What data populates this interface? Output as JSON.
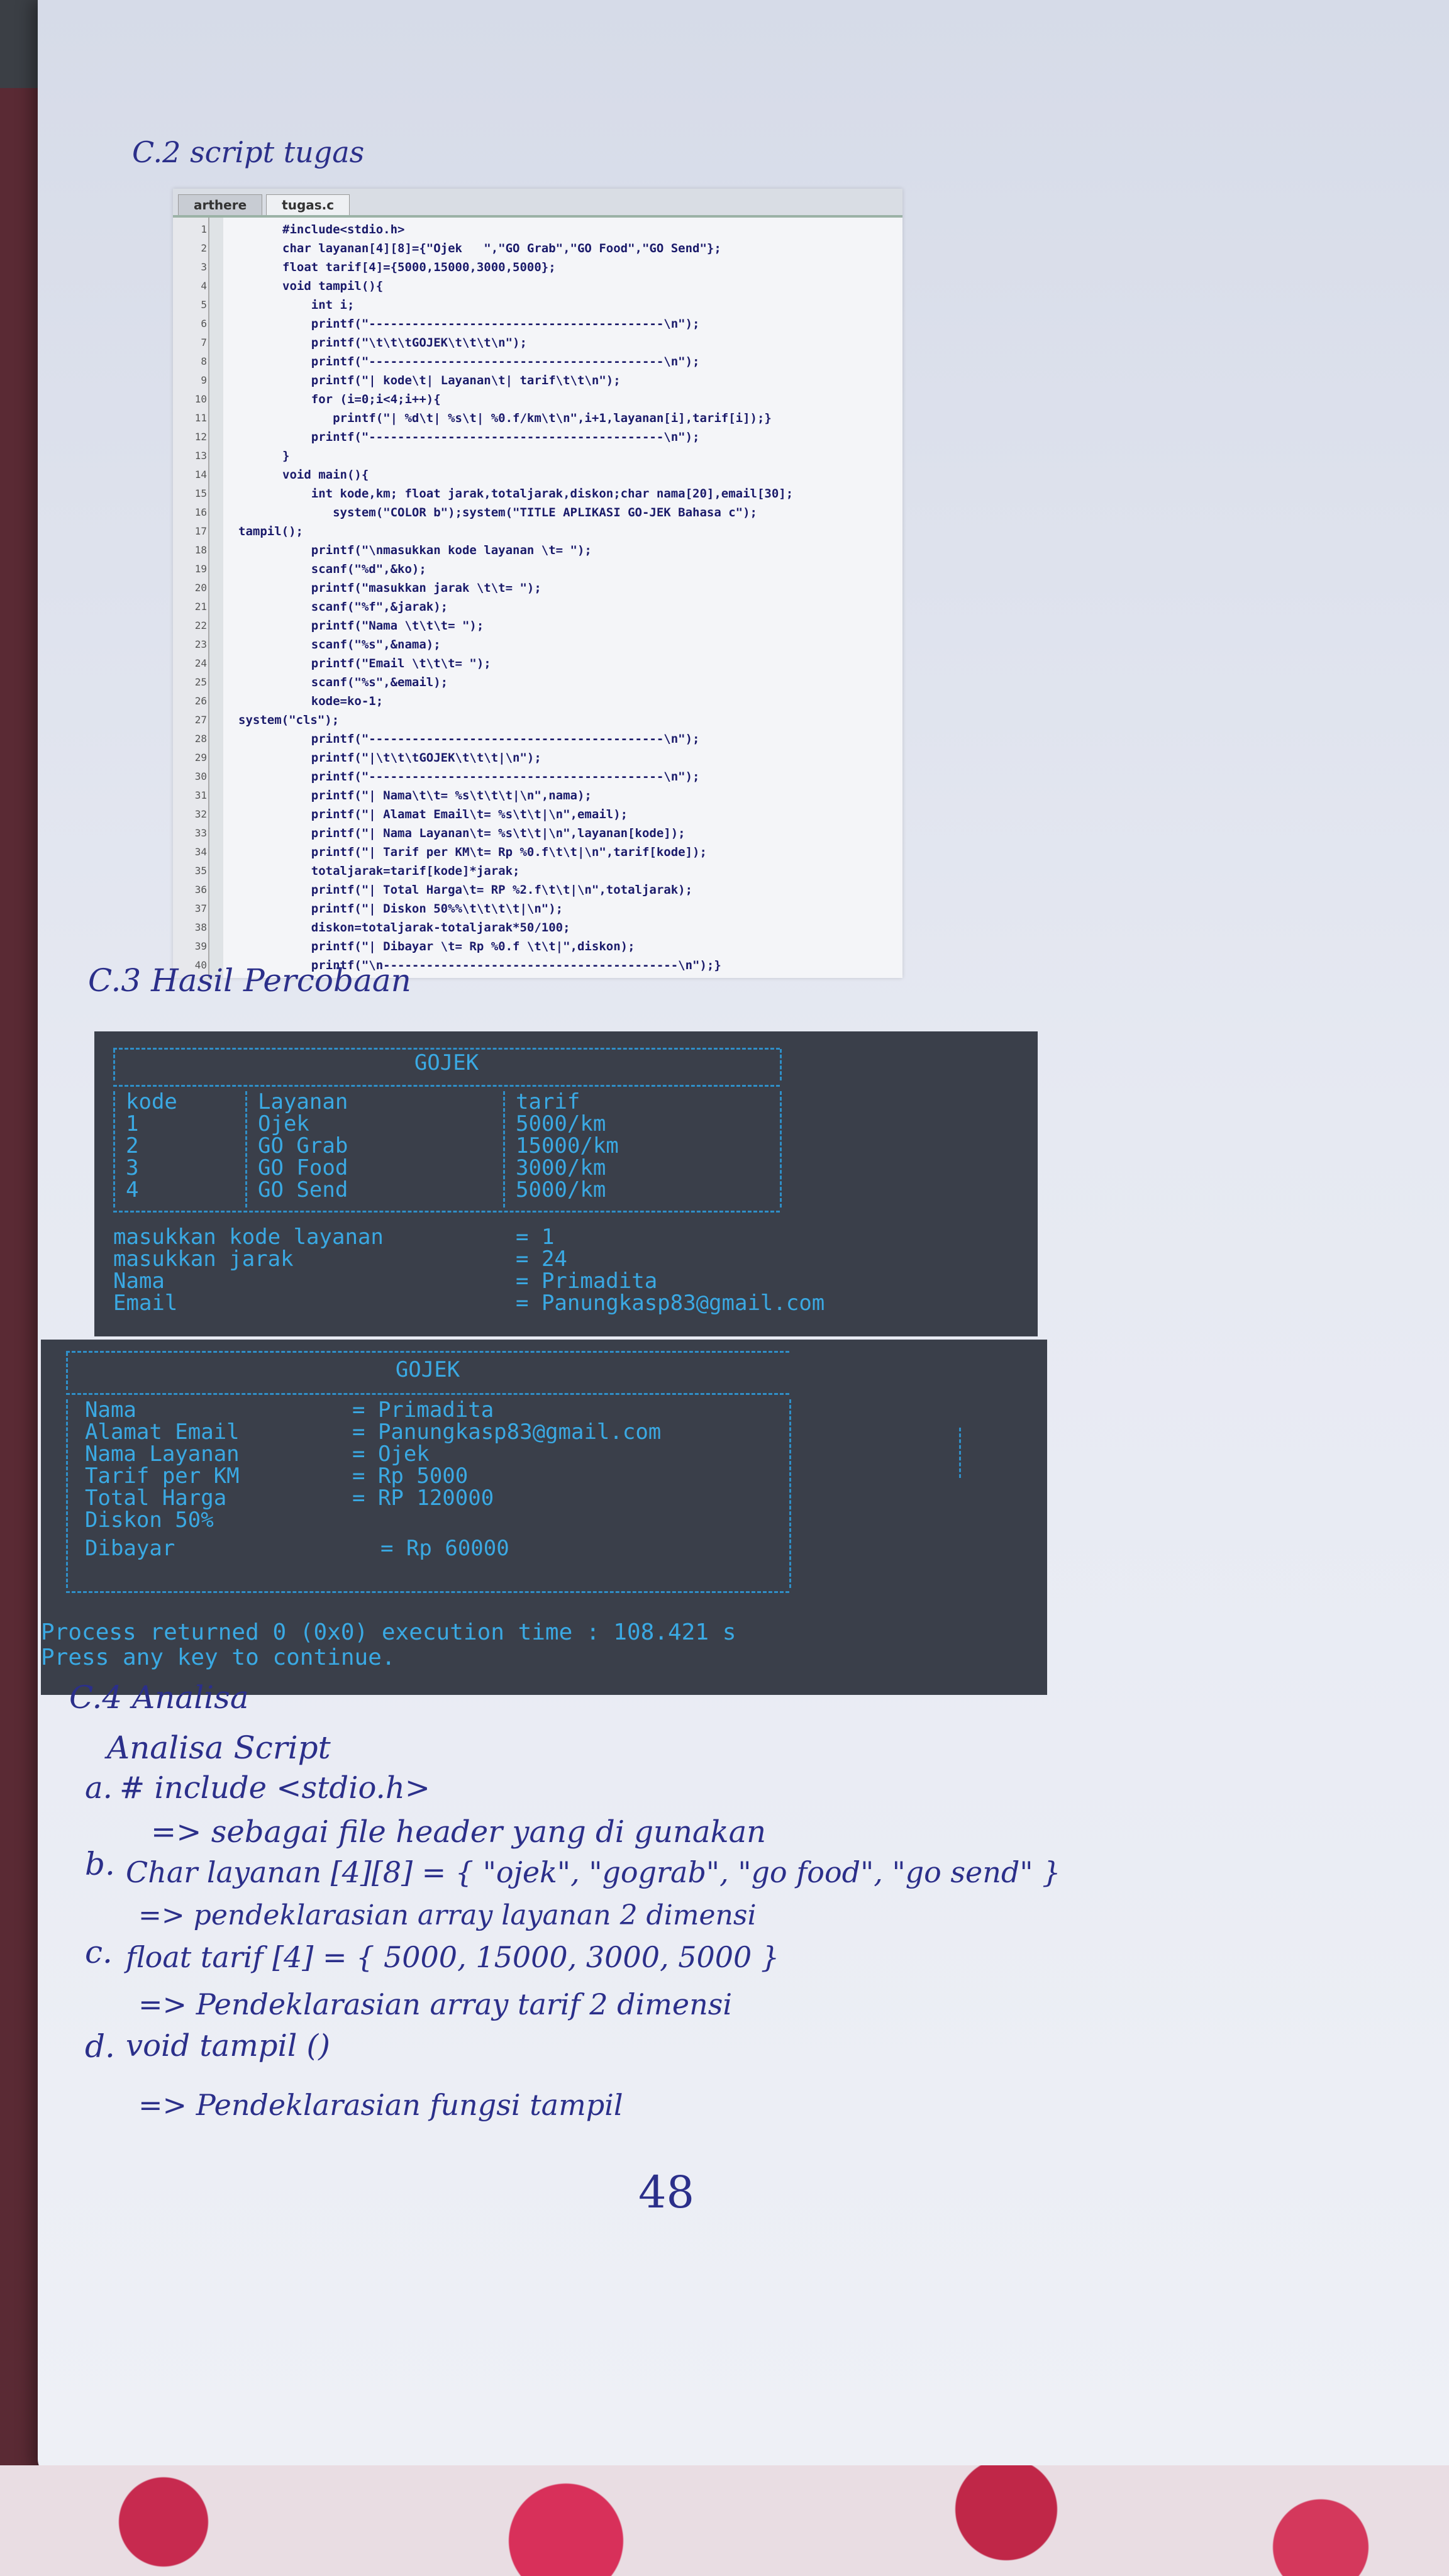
{
  "section_c2_title": "C.2 script tugas",
  "editor": {
    "tabs": [
      "arthere",
      "tugas.c"
    ],
    "lines": [
      {
        "n": "1",
        "t": "#include<stdio.h>",
        "i": 0
      },
      {
        "n": "2",
        "t": "char layanan[4][8]={\"Ojek   \",\"GO Grab\",\"GO Food\",\"GO Send\"};",
        "i": 0
      },
      {
        "n": "3",
        "t": "float tarif[4]={5000,15000,3000,5000};",
        "i": 0
      },
      {
        "n": "4",
        "t": "void tampil(){",
        "i": 0
      },
      {
        "n": "5",
        "t": "    int i;",
        "i": 0
      },
      {
        "n": "6",
        "t": "    printf(\"-----------------------------------------\\n\");",
        "i": 0
      },
      {
        "n": "7",
        "t": "    printf(\"\\t\\t\\tGOJEK\\t\\t\\t\\n\");",
        "i": 0
      },
      {
        "n": "8",
        "t": "    printf(\"-----------------------------------------\\n\");",
        "i": 0
      },
      {
        "n": "9",
        "t": "    printf(\"| kode\\t| Layanan\\t| tarif\\t\\t\\n\");",
        "i": 0
      },
      {
        "n": "10",
        "t": "    for (i=0;i<4;i++){",
        "i": 0
      },
      {
        "n": "11",
        "t": "       printf(\"| %d\\t| %s\\t| %0.f/km\\t\\n\",i+1,layanan[i],tarif[i]);}",
        "i": 0
      },
      {
        "n": "12",
        "t": "    printf(\"-----------------------------------------\\n\");",
        "i": 0
      },
      {
        "n": "13",
        "t": "}",
        "i": 0
      },
      {
        "n": "14",
        "t": "void main(){",
        "i": 0
      },
      {
        "n": "15",
        "t": "    int kode,km; float jarak,totaljarak,diskon;char nama[20],email[30];",
        "i": 0
      },
      {
        "n": "16",
        "t": "       system(\"COLOR b\");system(\"TITLE APLIKASI GO-JEK Bahasa c\");",
        "i": 0
      },
      {
        "n": "17",
        "t": "tampil();",
        "i": -1
      },
      {
        "n": "18",
        "t": "    printf(\"\\nmasukkan kode layanan \\t= \");",
        "i": 0
      },
      {
        "n": "19",
        "t": "    scanf(\"%d\",&ko);",
        "i": 0
      },
      {
        "n": "20",
        "t": "    printf(\"masukkan jarak \\t\\t= \");",
        "i": 0
      },
      {
        "n": "21",
        "t": "    scanf(\"%f\",&jarak);",
        "i": 0
      },
      {
        "n": "22",
        "t": "    printf(\"Nama \\t\\t\\t= \");",
        "i": 0
      },
      {
        "n": "23",
        "t": "    scanf(\"%s\",&nama);",
        "i": 0
      },
      {
        "n": "24",
        "t": "    printf(\"Email \\t\\t\\t= \");",
        "i": 0
      },
      {
        "n": "25",
        "t": "    scanf(\"%s\",&email);",
        "i": 0
      },
      {
        "n": "26",
        "t": "    kode=ko-1;",
        "i": 0
      },
      {
        "n": "27",
        "t": "system(\"cls\");",
        "i": -1
      },
      {
        "n": "28",
        "t": "    printf(\"-----------------------------------------\\n\");",
        "i": 0
      },
      {
        "n": "29",
        "t": "    printf(\"|\\t\\t\\tGOJEK\\t\\t\\t|\\n\");",
        "i": 0
      },
      {
        "n": "30",
        "t": "    printf(\"-----------------------------------------\\n\");",
        "i": 0
      },
      {
        "n": "31",
        "t": "    printf(\"| Nama\\t\\t= %s\\t\\t\\t|\\n\",nama);",
        "i": 0
      },
      {
        "n": "32",
        "t": "    printf(\"| Alamat Email\\t= %s\\t\\t|\\n\",email);",
        "i": 0
      },
      {
        "n": "33",
        "t": "    printf(\"| Nama Layanan\\t= %s\\t\\t|\\n\",layanan[kode]);",
        "i": 0
      },
      {
        "n": "34",
        "t": "    printf(\"| Tarif per KM\\t= Rp %0.f\\t\\t|\\n\",tarif[kode]);",
        "i": 0
      },
      {
        "n": "35",
        "t": "    totaljarak=tarif[kode]*jarak;",
        "i": 0
      },
      {
        "n": "36",
        "t": "    printf(\"| Total Harga\\t= RP %2.f\\t\\t|\\n\",totaljarak);",
        "i": 0
      },
      {
        "n": "37",
        "t": "    printf(\"| Diskon 50%%\\t\\t\\t\\t|\\n\");",
        "i": 0
      },
      {
        "n": "38",
        "t": "    diskon=totaljarak-totaljarak*50/100;",
        "i": 0
      },
      {
        "n": "39",
        "t": "    printf(\"| Dibayar \\t= Rp %0.f \\t\\t|\",diskon);",
        "i": 0
      },
      {
        "n": "40",
        "t": "    printf(\"\\n-----------------------------------------\\n\");}",
        "i": 0
      }
    ]
  },
  "section_c3_title": "C.3 Hasil Percobaan",
  "terminal1": {
    "title": "GOJEK",
    "headers": [
      "kode",
      "Layanan",
      "tarif"
    ],
    "rows": [
      [
        "1",
        "Ojek",
        "5000/km"
      ],
      [
        "2",
        "GO Grab",
        "15000/km"
      ],
      [
        "3",
        "GO Food",
        "3000/km"
      ],
      [
        "4",
        "GO Send",
        "5000/km"
      ]
    ],
    "inputs": [
      {
        "label": "masukkan kode layanan",
        "value": "= 1"
      },
      {
        "label": "masukkan jarak",
        "value": "= 24"
      },
      {
        "label": "Nama",
        "value": "= Primadita"
      },
      {
        "label": "Email",
        "value": "= Panungkasp83@gmail.com"
      }
    ]
  },
  "terminal2": {
    "title": "GOJEK",
    "rows": [
      {
        "label": "Nama",
        "value": "= Primadita"
      },
      {
        "label": "Alamat Email",
        "value": "= Panungkasp83@gmail.com"
      },
      {
        "label": "Nama Layanan",
        "value": "= Ojek"
      },
      {
        "label": "Tarif per KM",
        "value": "= Rp 5000"
      },
      {
        "label": "Total Harga",
        "value": "= RP 120000"
      },
      {
        "label": "Diskon 50%",
        "value": ""
      },
      {
        "label": "Dibayar",
        "value": "= Rp 60000"
      }
    ],
    "process_line": "Process returned 0 (0x0)   execution time : 108.421 s",
    "continue_line": "Press any key to continue."
  },
  "analysis": {
    "title": "C.4 Analisa",
    "subtitle": "Analisa Script",
    "items": [
      {
        "label": "a.",
        "code": "# include <stdio.h>",
        "note": "=> sebagai file header yang di gunakan"
      },
      {
        "label": "b.",
        "code": "Char layanan [4][8] = { \"ojek\", \"gograb\", \"go food\", \"go send\" }",
        "note": "=> pendeklarasian array layanan 2 dimensi"
      },
      {
        "label": "c.",
        "code": "float tarif [4] = { 5000, 15000, 3000, 5000 }",
        "note": "=> Pendeklarasian array tarif 2 dimensi"
      },
      {
        "label": "d.",
        "code": "void tampil ()",
        "note": "=> Pendeklarasian fungsi tampil"
      }
    ]
  },
  "page_number": "48"
}
